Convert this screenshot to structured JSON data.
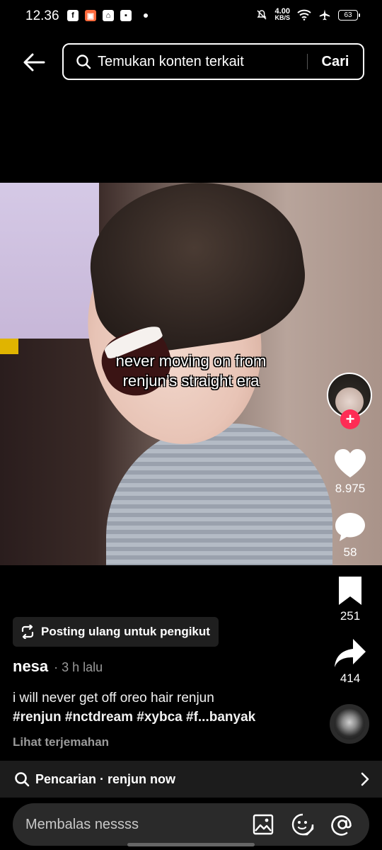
{
  "status_bar": {
    "time": "12.36",
    "speed_value": "4.00",
    "speed_unit": "KB/S",
    "battery": "63"
  },
  "header": {
    "search_text": "Temukan konten terkait",
    "search_button": "Cari"
  },
  "video": {
    "caption_line1": "never moving on from",
    "caption_line2": "renjun’s straight era"
  },
  "actions": {
    "likes": "8.975",
    "comments": "58",
    "saves": "251",
    "shares": "414"
  },
  "post": {
    "repost_label": "Posting ulang untuk pengikut",
    "author": "nesa",
    "time": "· 3 h lalu",
    "description": "i will never get off oreo hair renjun",
    "tags": "#renjun #nctdream #xybca #f...banyak",
    "translate": "Lihat terjemahan"
  },
  "search_suggestion": "Pencarian · renjun now",
  "reply": {
    "placeholder": "Membalas nessss"
  },
  "colors": {
    "accent": "#fe2c55",
    "background": "#000000",
    "chip": "#1f1f1f"
  }
}
